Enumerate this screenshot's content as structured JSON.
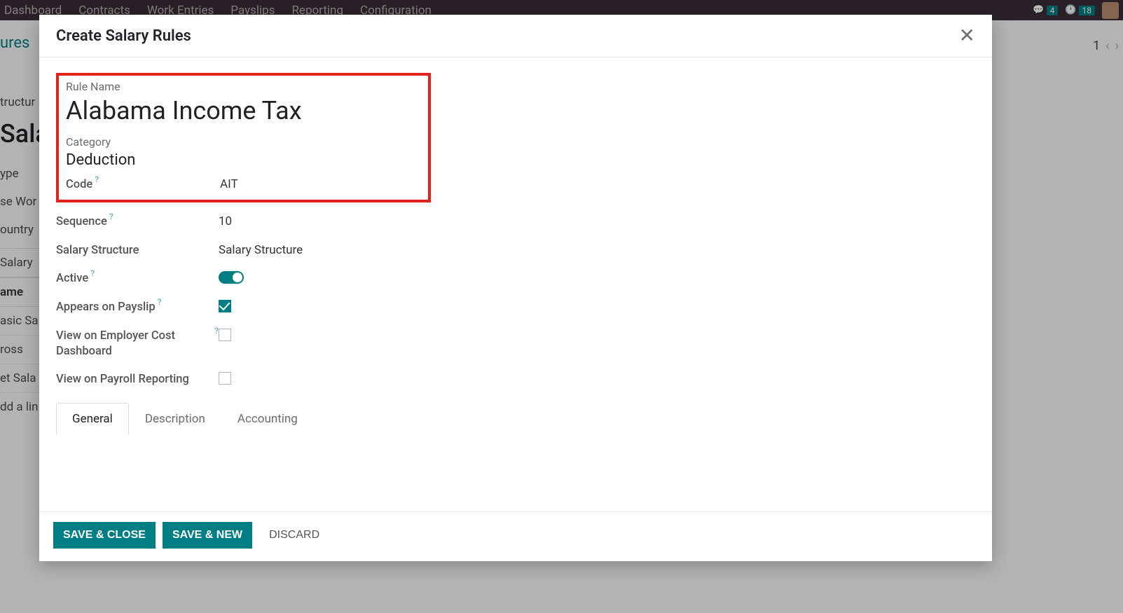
{
  "topbar": {
    "nav": [
      "Dashboard",
      "Contracts",
      "Work Entries",
      "Payslips",
      "Reporting",
      "Configuration"
    ],
    "msg_count": "4",
    "clock_count": "18"
  },
  "bg": {
    "breadcrumb": "ures",
    "title": "Sala",
    "pager": "1",
    "left_rows": [
      "tructur",
      "ype",
      "se Wor",
      "ountry",
      " Salary"
    ],
    "table_header": "ame",
    "table_rows": [
      "asic Sa",
      "ross",
      "et Sala"
    ],
    "add_line": "dd a lin"
  },
  "modal": {
    "title": "Create Salary Rules",
    "rule_name_label": "Rule Name",
    "rule_name_value": "Alabama Income Tax",
    "category_label": "Category",
    "category_value": "Deduction",
    "code_label": "Code",
    "code_value": "AIT",
    "sequence_label": "Sequence",
    "sequence_value": "10",
    "salary_structure_label": "Salary Structure",
    "salary_structure_value": "Salary Structure",
    "active_label": "Active",
    "active_value": true,
    "appears_label": "Appears on Payslip",
    "appears_value": true,
    "employer_cost_label": "View on Employer Cost Dashboard",
    "employer_cost_value": false,
    "payroll_reporting_label": "View on Payroll Reporting",
    "payroll_reporting_value": false,
    "tabs": [
      "General",
      "Description",
      "Accounting"
    ],
    "active_tab": 0,
    "save_close": "SAVE & CLOSE",
    "save_new": "SAVE & NEW",
    "discard": "DISCARD"
  }
}
